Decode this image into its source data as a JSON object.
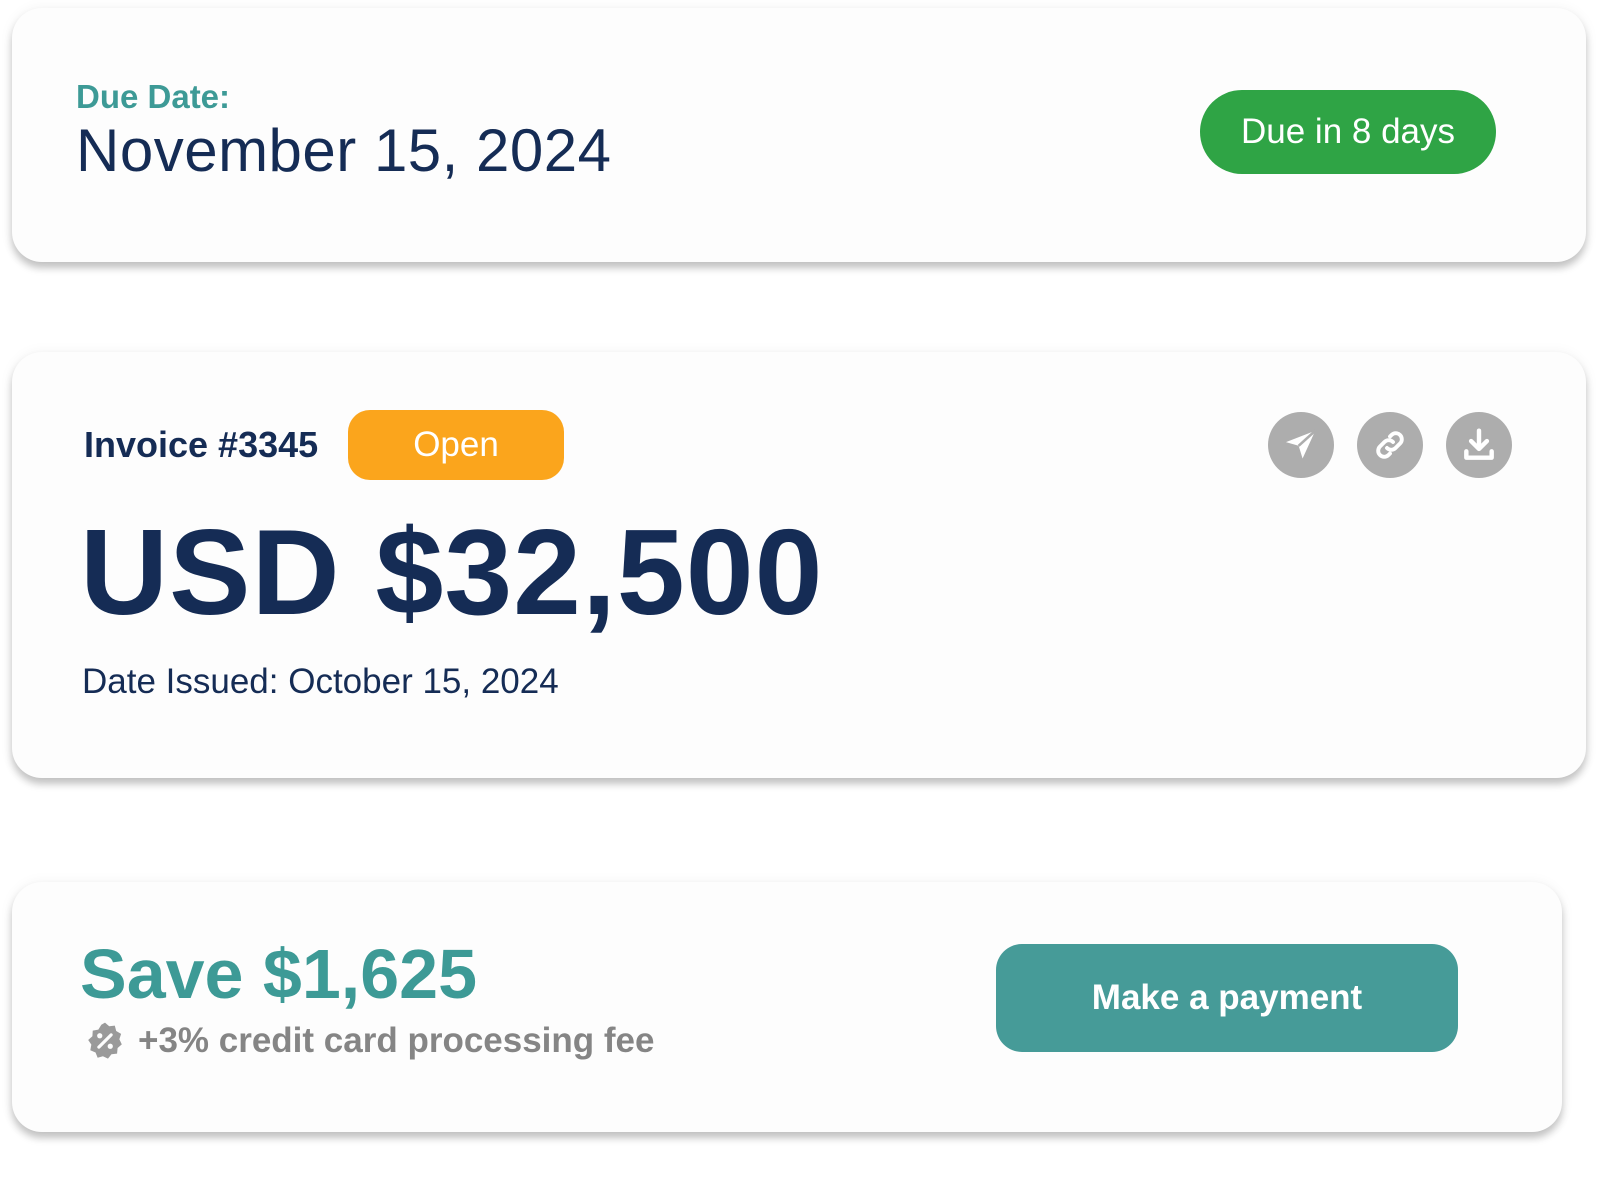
{
  "due_card": {
    "label": "Due Date:",
    "date": "November 15, 2024",
    "badge": "Due in 8 days",
    "badge_color": "#2fa445"
  },
  "invoice_card": {
    "number": "Invoice #3345",
    "status": "Open",
    "status_color": "#fba51c",
    "amount": "USD $32,500",
    "issued": "Date Issued: October 15, 2024",
    "actions": [
      {
        "icon": "send-icon"
      },
      {
        "icon": "link-icon"
      },
      {
        "icon": "download-icon"
      }
    ]
  },
  "payment_card": {
    "save": "Save $1,625",
    "fee_icon": "discount-badge-icon",
    "fee": "+3% credit card processing fee",
    "button": "Make a payment",
    "accent_color": "#469b98"
  }
}
